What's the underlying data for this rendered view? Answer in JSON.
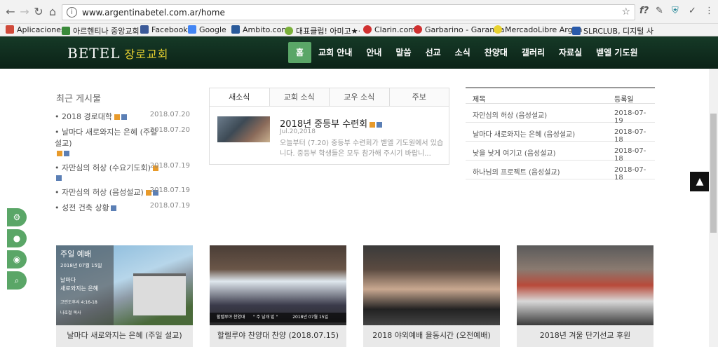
{
  "browser": {
    "url": "www.argentinabetel.com.ar/home"
  },
  "bookmarks": [
    {
      "label": "Aplicaciones",
      "color": "#d04a3a"
    },
    {
      "label": "아르헨티나 중앙교회",
      "color": "#3a8a3a"
    },
    {
      "label": "Facebook",
      "color": "#3b5998"
    },
    {
      "label": "Google",
      "color": "#4285f4"
    },
    {
      "label": "Ambito.com",
      "color": "#2a5a9a"
    },
    {
      "label": "대표클럽! 아미고★·",
      "color": "#7ab03a"
    },
    {
      "label": "Clarin.com",
      "color": "#d03030"
    },
    {
      "label": "Garbarino - Garantía",
      "color": "#d03030"
    },
    {
      "label": "MercadoLibre Argen",
      "color": "#e8d230"
    },
    {
      "label": "SLRCLUB, 디지털 사",
      "color": "#2a5aaa"
    }
  ],
  "site": {
    "logo": "BETEL",
    "logo_kr": "장로교회",
    "menu": [
      "홈",
      "교회 안내",
      "안내",
      "말씀",
      "선교",
      "소식",
      "찬양대",
      "갤러리",
      "자료실",
      "벧엘 기도원"
    ]
  },
  "recent": {
    "title": "최근 게시물",
    "items": [
      {
        "text": "• 2018 경로대학",
        "date": "2018.07.20"
      },
      {
        "text": "• 날마다 새로와지는 은혜 (주일 설교)",
        "date": "2018.07.20"
      },
      {
        "text": "• 자만심의 허상 (수요기도회)",
        "date": "2018.07.19"
      },
      {
        "text": "• 자만심의 허상 (음성설교)",
        "date": "2018.07.19"
      },
      {
        "text": "• 성전 건축 상황",
        "date": "2018.07.19"
      }
    ]
  },
  "news": {
    "tabs": [
      "새소식",
      "교회 소식",
      "교우 소식",
      "주보"
    ],
    "title": "2018년 중등부 수련회",
    "date": "Jul.20,2018",
    "body": "오늘부터 (7.20) 중등부 수련회가 벧엘 기도원에서 있습니다. 중등부 학생들은 모두 참가해 주시기 바랍니..."
  },
  "sermons": {
    "headers": [
      "제목",
      "등록일"
    ],
    "rows": [
      {
        "title": "자만심의 허상 (음성설교)",
        "date": "2018-07-19"
      },
      {
        "title": "날마다 새로와지는 은혜 (음성설교)",
        "date": "2018-07-18"
      },
      {
        "title": "낮을 낮게 여기고 (음성설교)",
        "date": "2018-07-18"
      },
      {
        "title": "하나님의 프로젝트 (음성설교)",
        "date": "2018-07-18"
      }
    ]
  },
  "cards": [
    {
      "caption": "날마다 새로와지는 은혜 (주일 설교)",
      "ov1": "주일 예배",
      "ov2": "2018년 07월 15일",
      "ov3": "날마다\n새로와지는 은혜",
      "ov4": "고린도후서 4:16-18",
      "ov5": "나호철 목사"
    },
    {
      "caption": "할렐루야 찬양대 찬양 (2018.07.15)",
      "strip": "할렐루야 찬양대      \" 주 날개 밑 \"           2018년 07월 15일"
    },
    {
      "caption": "2018 야외예배 율동시간 (오전예배)"
    },
    {
      "caption": "2018년 겨울 단기선교 후원"
    }
  ]
}
